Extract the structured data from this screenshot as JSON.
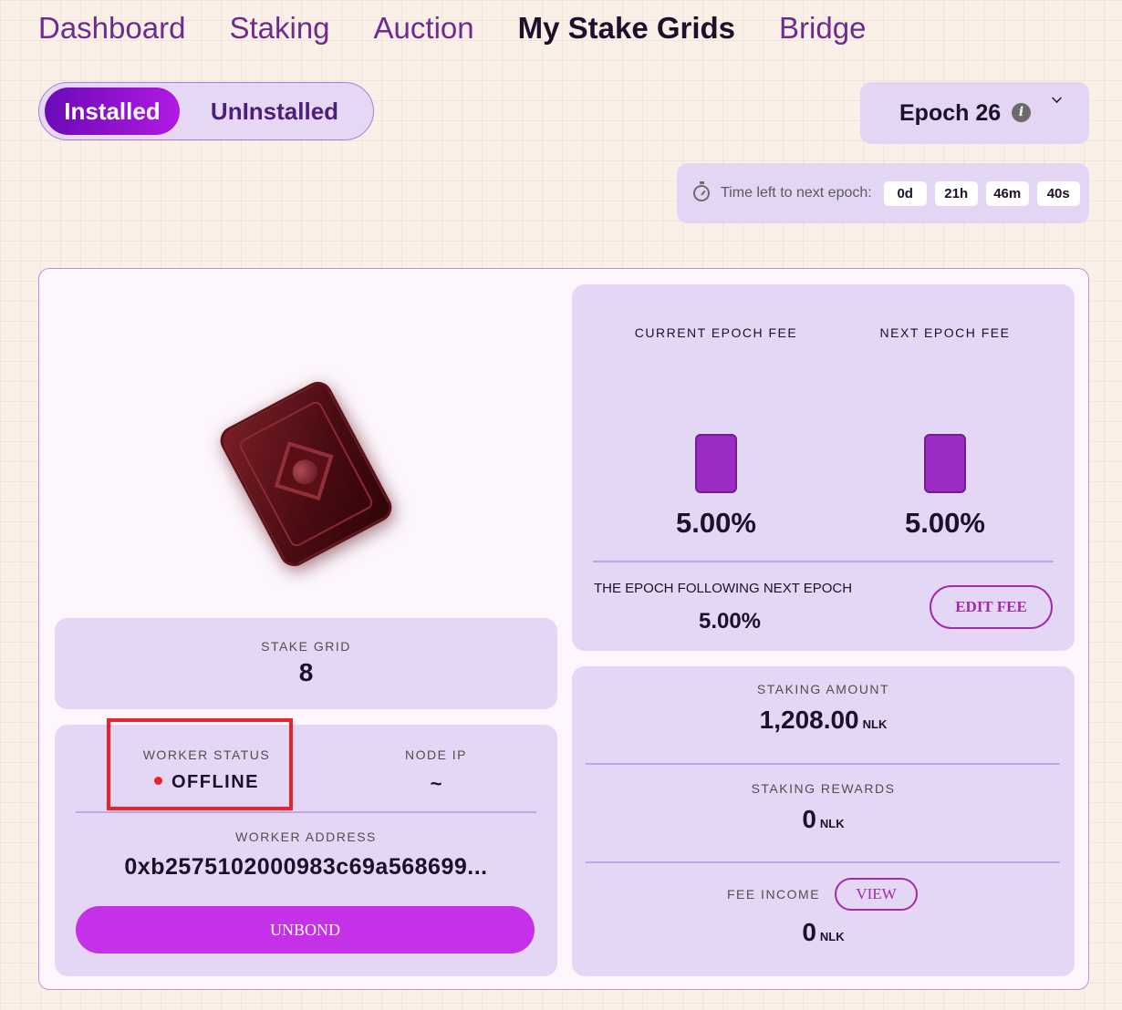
{
  "nav": {
    "items": [
      {
        "label": "Dashboard"
      },
      {
        "label": "Staking"
      },
      {
        "label": "Auction"
      },
      {
        "label": "My Stake Grids",
        "active": true
      },
      {
        "label": "Bridge"
      }
    ]
  },
  "toggle": {
    "installed": "Installed",
    "uninstalled": "UnInstalled",
    "selected": "Installed"
  },
  "epoch": {
    "label": "Epoch 26",
    "info_icon": "info-icon",
    "dropdown_icon": "chevron-down-icon"
  },
  "timer": {
    "icon": "stopwatch-icon",
    "label": "Time left to next epoch:",
    "days": "0d",
    "hours": "21h",
    "minutes": "46m",
    "seconds": "40s"
  },
  "grid": {
    "stake_grid_label": "STAKE GRID",
    "stake_grid_value": "8",
    "worker_status_label": "WORKER STATUS",
    "worker_status_value": "OFFLINE",
    "node_ip_label": "NODE IP",
    "node_ip_value": "~",
    "worker_address_label": "WORKER ADDRESS",
    "worker_address_value": "0xb2575102000983c69a568699...",
    "unbond_label": "UNBOND"
  },
  "fees": {
    "current_label": "CURRENT EPOCH FEE",
    "current_value": "5.00%",
    "next_label": "NEXT EPOCH FEE",
    "next_value": "5.00%",
    "following_label": "THE EPOCH FOLLOWING NEXT EPOCH",
    "following_value": "5.00%",
    "edit_label": "EDIT FEE"
  },
  "staking": {
    "amount_label": "STAKING AMOUNT",
    "amount_value": "1,208.00",
    "rewards_label": "STAKING REWARDS",
    "rewards_value": "0",
    "fee_income_label": "FEE INCOME",
    "fee_income_value": "0",
    "view_label": "VIEW",
    "unit": "NLK"
  },
  "colors": {
    "accent": "#c431e9",
    "status_offline": "#e8242a",
    "panel": "#e4d6f5"
  }
}
